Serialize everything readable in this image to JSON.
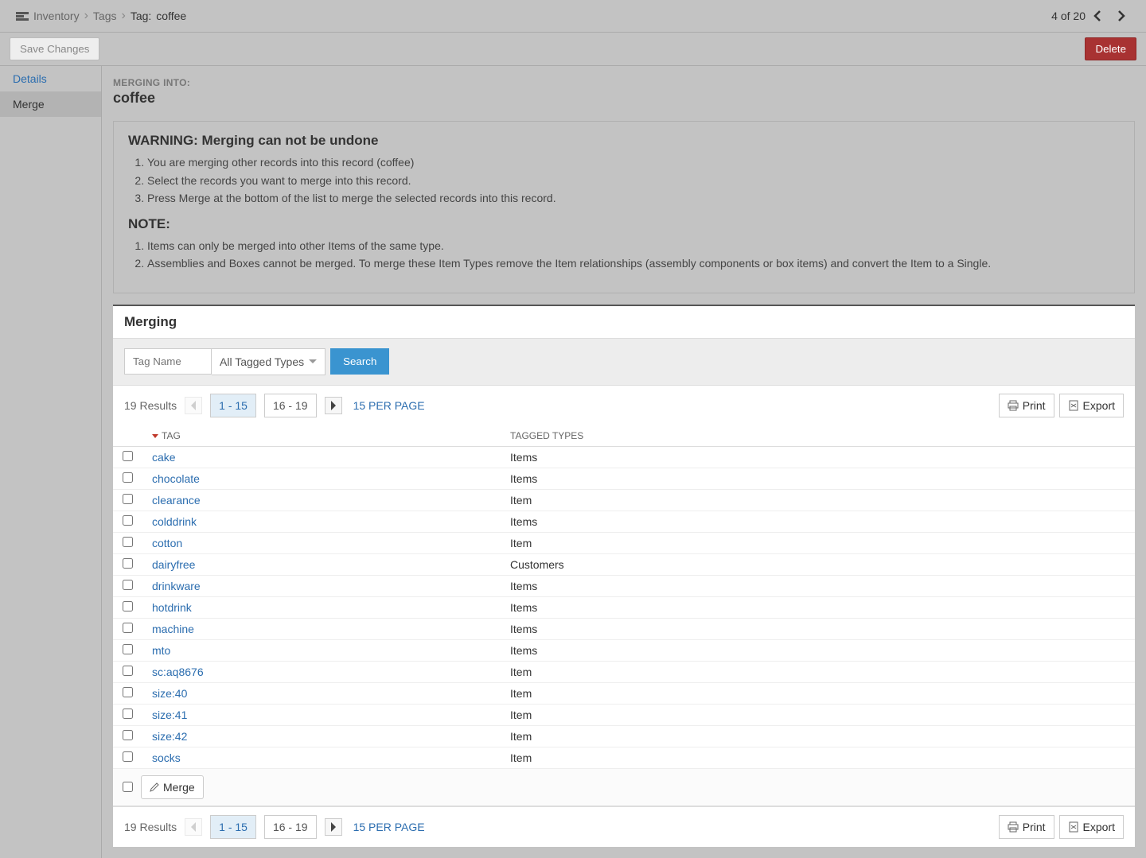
{
  "breadcrumb": {
    "root": "Inventory",
    "mid": "Tags",
    "prefix": "Tag:",
    "current": "coffee"
  },
  "pager": {
    "text": "4 of 20"
  },
  "toolbar": {
    "save_label": "Save Changes",
    "delete_label": "Delete"
  },
  "sidebar": {
    "items": [
      {
        "label": "Details",
        "active": false
      },
      {
        "label": "Merge",
        "active": true
      }
    ]
  },
  "merge": {
    "heading": "MERGING INTO:",
    "target": "coffee",
    "warning_title": "WARNING: Merging can not be undone",
    "warning_items": [
      "You are merging other records into this record (coffee)",
      "Select the records you want to merge into this record.",
      "Press Merge at the bottom of the list to merge the selected records into this record."
    ],
    "note_title": "NOTE:",
    "note_items": [
      "Items can only be merged into other Items of the same type.",
      "Assemblies and Boxes cannot be merged. To merge these Item Types remove the Item relationships (assembly components or box items) and convert the Item to a Single."
    ]
  },
  "panel": {
    "title": "Merging",
    "search": {
      "placeholder": "Tag Name",
      "filter": "All Tagged Types",
      "button": "Search"
    },
    "results_count": "19 Results",
    "pages": [
      "1 - 15",
      "16 - 19"
    ],
    "per_page": "15 PER PAGE",
    "print": "Print",
    "export": "Export",
    "columns": {
      "tag": "TAG",
      "types": "TAGGED TYPES"
    },
    "rows": [
      {
        "tag": "cake",
        "types": "Items"
      },
      {
        "tag": "chocolate",
        "types": "Items"
      },
      {
        "tag": "clearance",
        "types": "Item"
      },
      {
        "tag": "colddrink",
        "types": "Items"
      },
      {
        "tag": "cotton",
        "types": "Item"
      },
      {
        "tag": "dairyfree",
        "types": "Customers"
      },
      {
        "tag": "drinkware",
        "types": "Items"
      },
      {
        "tag": "hotdrink",
        "types": "Items"
      },
      {
        "tag": "machine",
        "types": "Items"
      },
      {
        "tag": "mto",
        "types": "Items"
      },
      {
        "tag": "sc:aq8676",
        "types": "Item"
      },
      {
        "tag": "size:40",
        "types": "Item"
      },
      {
        "tag": "size:41",
        "types": "Item"
      },
      {
        "tag": "size:42",
        "types": "Item"
      },
      {
        "tag": "socks",
        "types": "Item"
      }
    ],
    "merge_button": "Merge"
  }
}
